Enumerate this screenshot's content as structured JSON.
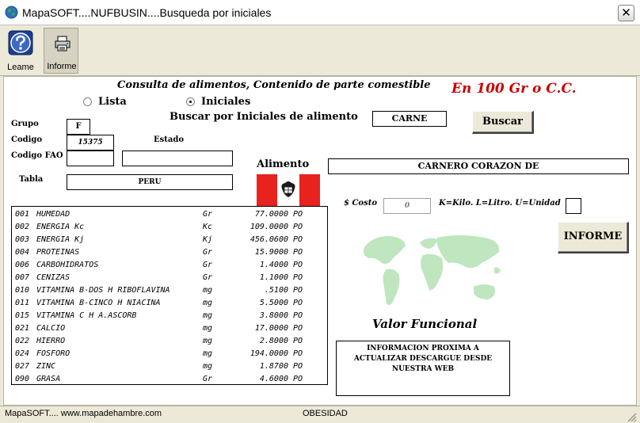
{
  "window": {
    "title": "MapaSOFT....NUFBUSIN....Busqueda por iniciales",
    "close_glyph": "✕",
    "icon": "globe-icon"
  },
  "toolbar": {
    "leame_label": "Leame",
    "informe_label": "Informe",
    "leame_icon": "help-icon",
    "informe_icon": "printer-icon"
  },
  "form": {
    "heading": "Consulta de alimentos, Contenido de parte comestible",
    "per100": "En 100 Gr  o C.C.",
    "radio_lista": "Lista",
    "radio_iniciales": "Iniciales",
    "selected_mode": "Iniciales",
    "buscar_label": "Buscar por Iniciales de alimento",
    "search_value": "CARNE",
    "buscar_button": "Buscar",
    "grupo_label": "Grupo",
    "grupo_value": "F",
    "codigo_label": "Codigo",
    "codigo_value": "15375",
    "codigo_fao_label": "Codigo FAO",
    "codigo_fao_value": "",
    "estado_label": "Estado",
    "estado_value": "",
    "tabla_label": "Tabla",
    "tabla_value": "PERU",
    "alimento_label": "Alimento",
    "alimento_value": "CARNERO  CORAZON DE",
    "costo_label": "$ Costo",
    "costo_value": "0",
    "unit_hint": "K=Kilo. L=Litro. U=Unidad",
    "unit_value": "",
    "informe_button": "INFORME",
    "valor_funcional": "Valor Funcional",
    "info_text": "INFORMACION PROXIMA A ACTUALIZAR  DESCARGUE DESDE NUESTRA WEB"
  },
  "nutrients": [
    {
      "code": "001",
      "name": "HUMEDAD",
      "unit": "Gr",
      "value": "77.0000",
      "src": "PO"
    },
    {
      "code": "002",
      "name": "ENERGIA Kc",
      "unit": "Kc",
      "value": "109.0000",
      "src": "PO"
    },
    {
      "code": "003",
      "name": "ENERGIA Kj",
      "unit": "Kj",
      "value": "456.0600",
      "src": "PO"
    },
    {
      "code": "004",
      "name": "PROTEINAS",
      "unit": "Gr",
      "value": "15.9000",
      "src": "PO"
    },
    {
      "code": "006",
      "name": "CARBOHIDRATOS",
      "unit": "Gr",
      "value": "1.4000",
      "src": "PO"
    },
    {
      "code": "007",
      "name": "CENIZAS",
      "unit": "Gr",
      "value": "1.1000",
      "src": "PO"
    },
    {
      "code": "010",
      "name": "VITAMINA B-DOS H RIBOFLAVINA",
      "unit": "mg",
      "value": ".5100",
      "src": "PO"
    },
    {
      "code": "011",
      "name": "VITAMINA B-CINCO H NIACINA",
      "unit": "mg",
      "value": "5.5000",
      "src": "PO"
    },
    {
      "code": "015",
      "name": "VITAMINA C H A.ASCORB",
      "unit": "mg",
      "value": "3.8000",
      "src": "PO"
    },
    {
      "code": "021",
      "name": "CALCIO",
      "unit": "mg",
      "value": "17.0000",
      "src": "PO"
    },
    {
      "code": "022",
      "name": "HIERRO",
      "unit": "mg",
      "value": "2.8000",
      "src": "PO"
    },
    {
      "code": "024",
      "name": "FOSFORO",
      "unit": "mg",
      "value": "194.0000",
      "src": "PO"
    },
    {
      "code": "027",
      "name": "ZINC",
      "unit": "mg",
      "value": "1.8700",
      "src": "PO"
    },
    {
      "code": "090",
      "name": "GRASA",
      "unit": "Gr",
      "value": "4.6000",
      "src": "PO"
    }
  ],
  "status": {
    "left": "MapaSOFT.... www.mapadehambre.com",
    "center": "OBESIDAD"
  },
  "colors": {
    "accent_red": "#cc0000",
    "flag_red": "#e8221f",
    "map_green": "#bfe6bf"
  }
}
